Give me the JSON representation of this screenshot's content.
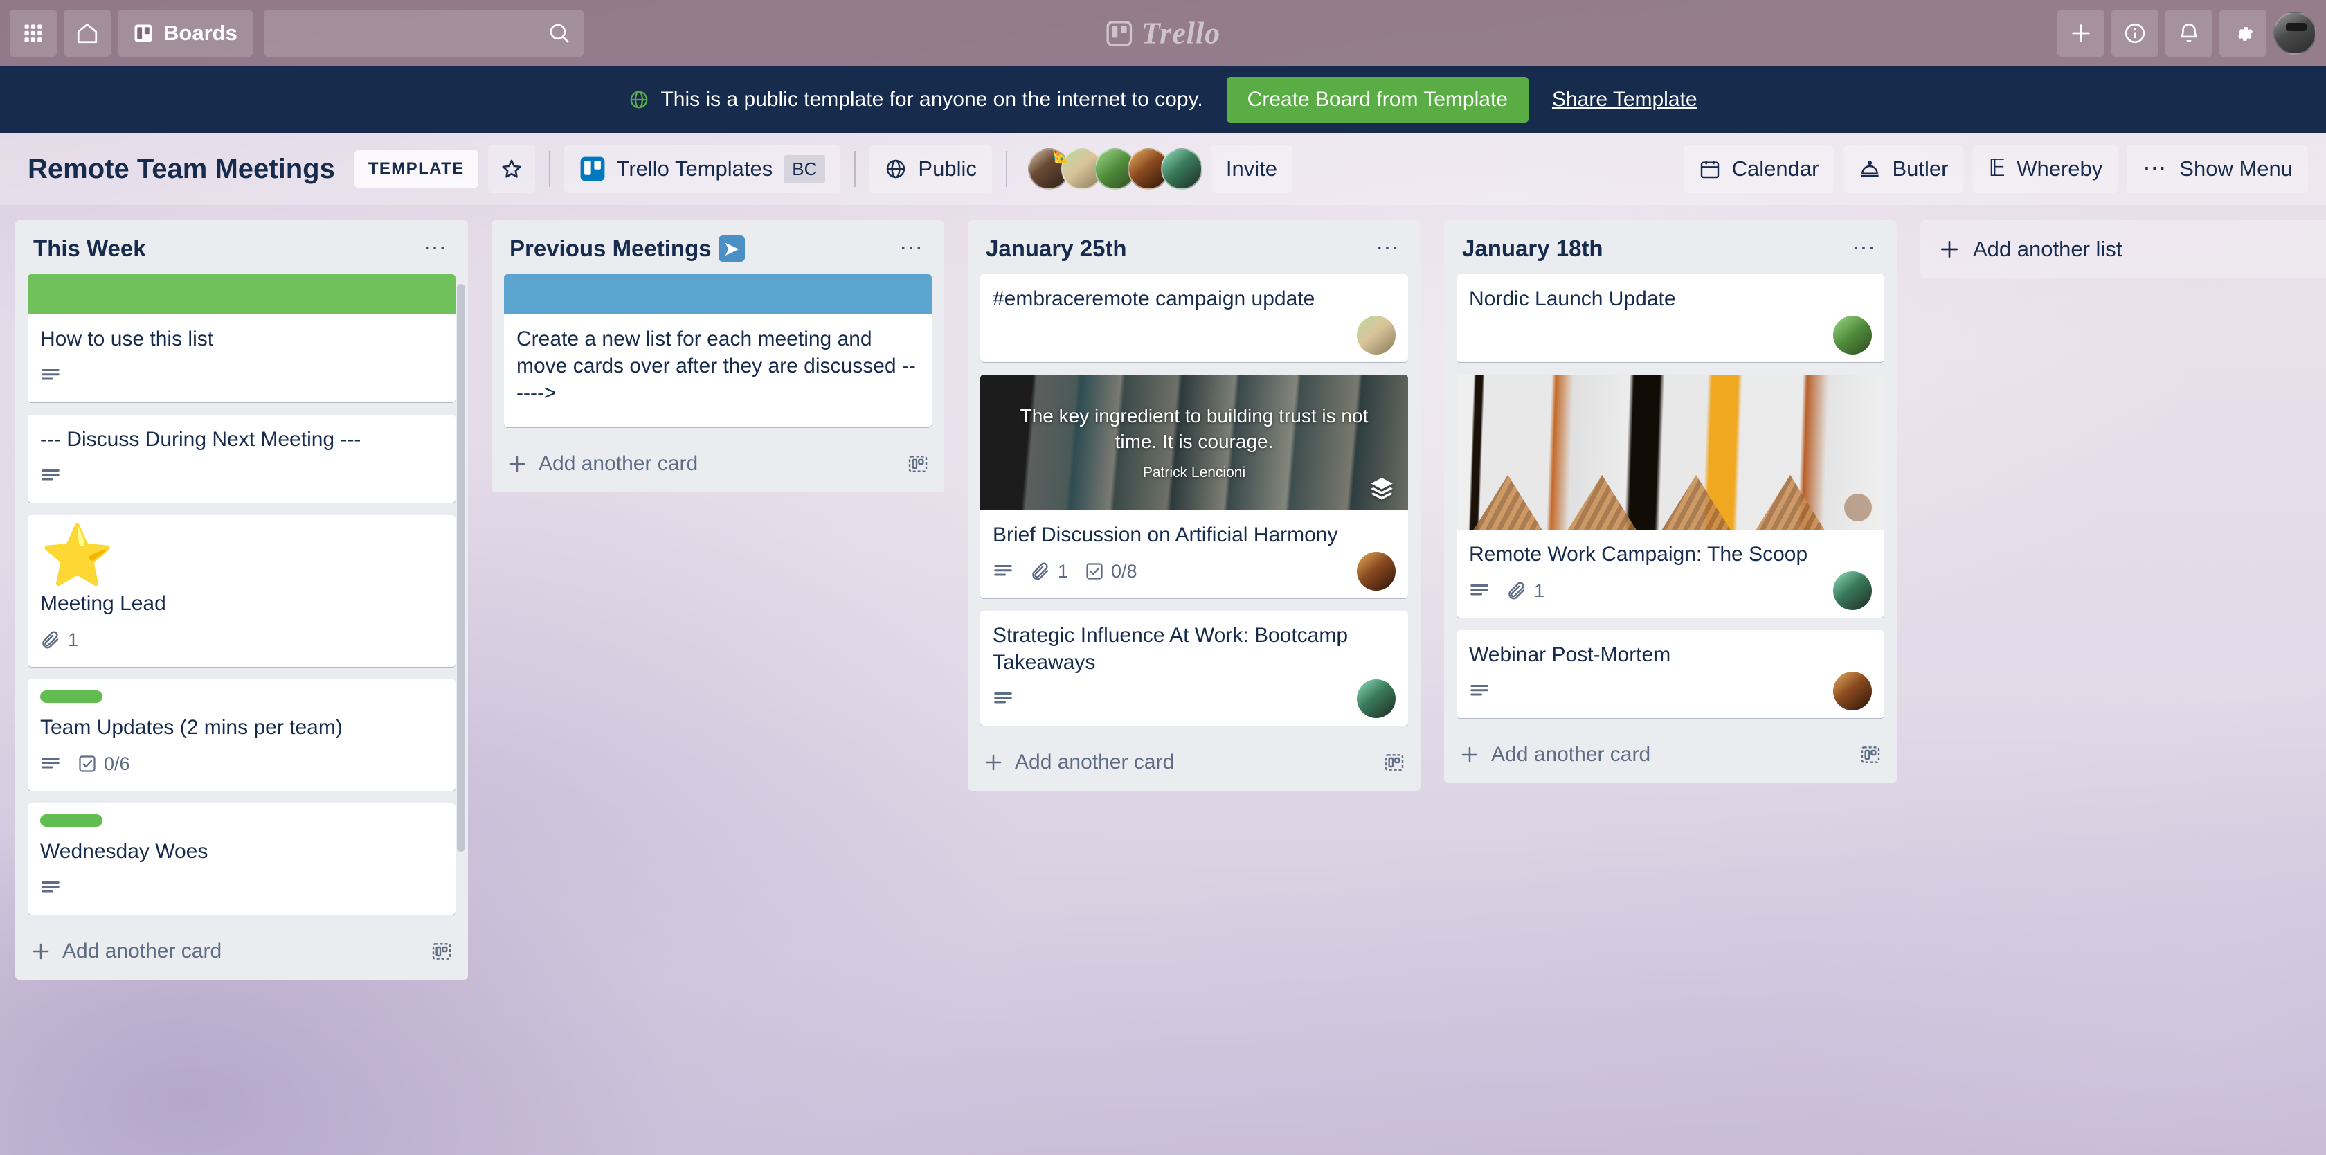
{
  "topnav": {
    "apps_icon": "grid-apps-icon",
    "home_icon": "home-icon",
    "boards_label": "Boards",
    "boards_icon": "board-icon",
    "search_placeholder": "",
    "search_value": "",
    "search_icon": "search-icon",
    "logo_text": "Trello",
    "add_icon": "plus-icon",
    "info_icon": "info-icon",
    "notifications_icon": "bell-icon",
    "settings_icon": "gear-icon",
    "avatar": "user-avatar"
  },
  "template_banner": {
    "globe_icon": "globe-icon",
    "message": "This is a public template for anyone on the internet to copy.",
    "create_button": "Create Board from Template",
    "share_link": "Share Template"
  },
  "board_header": {
    "title": "Remote Team Meetings",
    "template_chip": "TEMPLATE",
    "star_icon": "star-outline-icon",
    "workspace_icon": "trello-board-icon",
    "workspace_name": "Trello Templates",
    "workspace_badge": "BC",
    "visibility_icon": "globe-icon",
    "visibility": "Public",
    "members": [
      "member-1",
      "member-2",
      "member-3",
      "member-4",
      "member-5"
    ],
    "invite_label": "Invite",
    "calendar_icon": "calendar-icon",
    "calendar_label": "Calendar",
    "butler_icon": "butler-bell-icon",
    "butler_label": "Butler",
    "whereby_icon": "whereby-icon",
    "whereby_label": "Whereby",
    "menu_icon": "ellipsis-icon",
    "menu_label": "Show Menu"
  },
  "colors": {
    "nav_bg": "#826878",
    "banner_bg": "#172b4d",
    "green_button": "#5aac44",
    "list_bg": "#ebecf0",
    "text_dark": "#172b4d",
    "text_muted": "#5e6c84",
    "card_cover_green": "#70c05b",
    "card_cover_blue": "#5ba4cf",
    "label_green": "#61bd4f"
  },
  "lists": [
    {
      "name": "This Week",
      "emoji": "",
      "menu_icon": "ellipsis-icon",
      "add_card_label": "Add another card",
      "template_icon": "card-template-icon",
      "cards": [
        {
          "title": "How to use this list",
          "cover_color": "#70c05b",
          "badges": {
            "description": true
          }
        },
        {
          "title": "--- Discuss During Next Meeting ---",
          "badges": {
            "description": true
          }
        },
        {
          "title": "Meeting Lead",
          "emoji": "⭐",
          "badges": {
            "attachments": "1"
          }
        },
        {
          "title": "Team Updates (2 mins per team)",
          "label": "#61bd4f",
          "badges": {
            "description": true,
            "checklist": "0/6"
          }
        },
        {
          "title": "Wednesday Woes",
          "label": "#61bd4f",
          "badges": {
            "description": true
          }
        }
      ]
    },
    {
      "name": "Previous Meetings",
      "emoji": "➡",
      "menu_icon": "ellipsis-icon",
      "add_card_label": "Add another card",
      "template_icon": "card-template-icon",
      "cards": [
        {
          "title": "Create a new list for each meeting and move cards over after they are discussed ------>",
          "cover_color": "#5ba4cf"
        }
      ]
    },
    {
      "name": "January 25th",
      "emoji": "",
      "menu_icon": "ellipsis-icon",
      "add_card_label": "Add another card",
      "template_icon": "card-template-icon",
      "cards": [
        {
          "title": "#embraceremote campaign update",
          "avatar": "a-green"
        },
        {
          "title": "Brief Discussion on Artificial Harmony",
          "cover_image": "quote",
          "cover_quote": "The key ingredient to building trust is not time. It is courage.",
          "cover_author": "Patrick Lencioni",
          "badges": {
            "description": true,
            "attachments": "1",
            "checklist": "0/8"
          },
          "avatar": "a-asian"
        },
        {
          "title": "Strategic Influence At Work: Bootcamp Takeaways",
          "badges": {
            "description": true
          },
          "avatar": "a-man"
        }
      ]
    },
    {
      "name": "January 18th",
      "emoji": "",
      "menu_icon": "ellipsis-icon",
      "add_card_label": "Add another card",
      "template_icon": "card-template-icon",
      "cards": [
        {
          "title": "Nordic Launch Update",
          "avatar": "a-indian"
        },
        {
          "title": "Remote Work Campaign: The Scoop",
          "cover_image": "cones",
          "badges": {
            "description": true,
            "attachments": "1"
          },
          "avatar": "a-man"
        },
        {
          "title": "Webinar Post-Mortem",
          "badges": {
            "description": true
          },
          "avatar": "a-asian"
        }
      ]
    }
  ],
  "add_list": {
    "label": "Add another list",
    "plus_icon": "plus-icon"
  }
}
